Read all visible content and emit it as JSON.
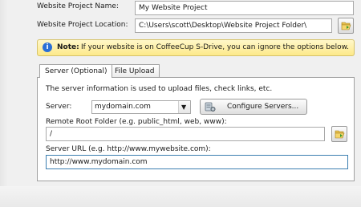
{
  "project": {
    "name_label": "Website Project Name:",
    "name_value": "My Website Project",
    "location_label": "Website Project Location:",
    "location_value": "C:\\Users\\scott\\Desktop\\Website Project Folder\\"
  },
  "note": {
    "label": "Note:",
    "text": "If your website is on CoffeeCup S-Drive, you can ignore the options below."
  },
  "tabs": [
    {
      "label": "Server (Optional)",
      "active": true
    },
    {
      "label": "File Upload",
      "active": false
    }
  ],
  "server_panel": {
    "description": "The server information is used to upload files, check links, etc.",
    "server_label": "Server:",
    "server_selected": "mydomain.com",
    "configure_button": "Configure Servers...",
    "remote_root_label": "Remote Root Folder (e.g. public_html, web, www):",
    "remote_root_value": "/",
    "server_url_label": "Server URL (e.g. http://www.mywebsite.com):",
    "server_url_value": "http://www.mydomain.com"
  },
  "icons": {
    "browse": "folder-open-icon",
    "configure": "server-settings-icon",
    "note": "info-icon",
    "dropdown": "chevron-down-icon"
  },
  "colors": {
    "note_background": "#fde98a",
    "note_border": "#d6c36a",
    "info_badge": "#2a6fd6",
    "url_field_border": "#3c7fb1"
  }
}
